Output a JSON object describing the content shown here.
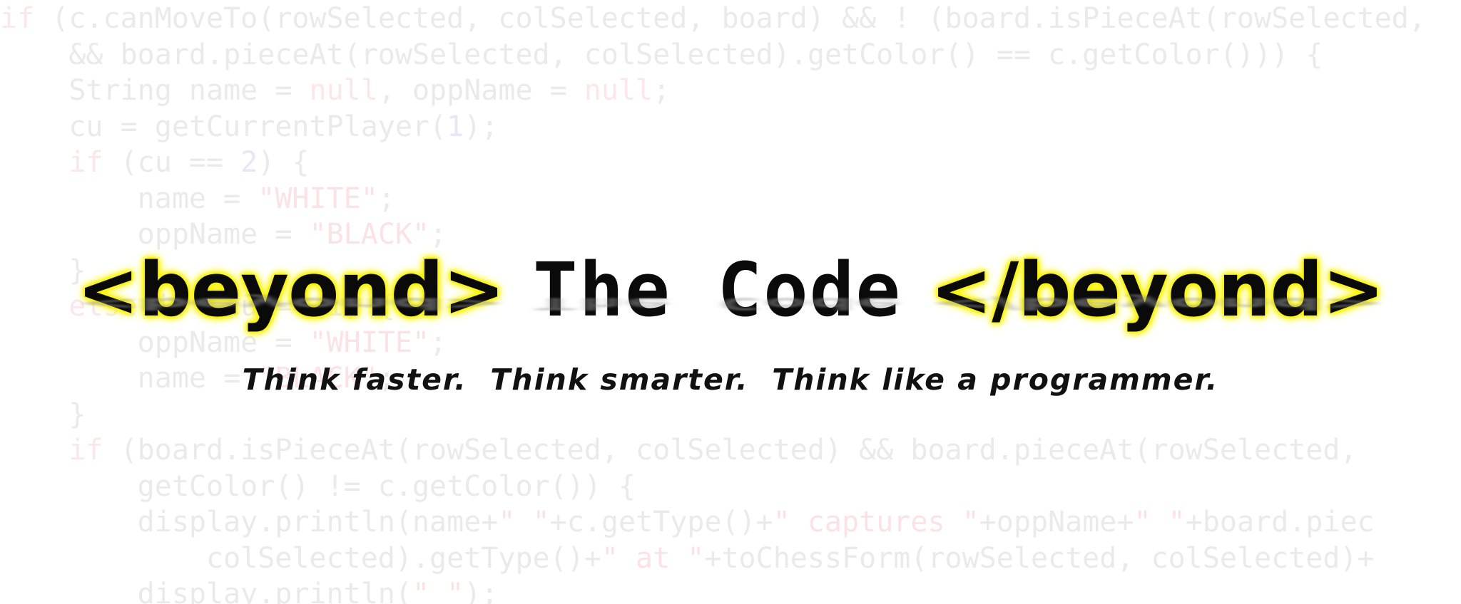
{
  "banner": {
    "open_tag": "<beyond>",
    "title": "The Code",
    "close_tag": "</beyond>",
    "tagline": "Think faster.  Think smarter.  Think like a programmer."
  },
  "code_background": [
    [
      {
        "t": "if",
        "c": "kw"
      },
      {
        "t": " (c.canMoveTo(rowSelected, colSelected, board) && ! (board.isPieceAt(rowSelected,"
      }
    ],
    [
      {
        "t": "    && board.pieceAt(rowSelected, colSelected).getColor() == c.getColor())) {"
      }
    ],
    [
      {
        "t": "    String name = "
      },
      {
        "t": "null",
        "c": "kw"
      },
      {
        "t": ", oppName = "
      },
      {
        "t": "null",
        "c": "kw"
      },
      {
        "t": ";"
      }
    ],
    [
      {
        "t": "    cu = getCurrentPlayer("
      },
      {
        "t": "1",
        "c": "num"
      },
      {
        "t": ");"
      }
    ],
    [
      {
        "t": "    "
      },
      {
        "t": "if",
        "c": "kw"
      },
      {
        "t": " (cu == "
      },
      {
        "t": "2",
        "c": "num"
      },
      {
        "t": ") {"
      }
    ],
    [
      {
        "t": "        name = "
      },
      {
        "t": "\"WHITE\"",
        "c": "str"
      },
      {
        "t": ";"
      }
    ],
    [
      {
        "t": "        oppName = "
      },
      {
        "t": "\"BLACK\"",
        "c": "str"
      },
      {
        "t": ";"
      }
    ],
    [
      {
        "t": "    }"
      }
    ],
    [
      {
        "t": "    "
      },
      {
        "t": "else",
        "c": "kw"
      },
      {
        "t": " if (cu == 1) {"
      }
    ],
    [
      {
        "t": "        oppName = "
      },
      {
        "t": "\"WHITE\"",
        "c": "str"
      },
      {
        "t": ";"
      }
    ],
    [
      {
        "t": "        name = "
      },
      {
        "t": "\"BLACK\"",
        "c": "str"
      },
      {
        "t": ";"
      }
    ],
    [
      {
        "t": "    }"
      }
    ],
    [
      {
        "t": "    "
      },
      {
        "t": "if",
        "c": "kw"
      },
      {
        "t": " (board.isPieceAt(rowSelected, colSelected) && board.pieceAt(rowSelected,"
      }
    ],
    [
      {
        "t": "        getColor() != c.getColor()) {"
      }
    ],
    [
      {
        "t": "        display.println(name+"
      },
      {
        "t": "\" \"",
        "c": "str"
      },
      {
        "t": "+c.getType()+"
      },
      {
        "t": "\" captures \"",
        "c": "str"
      },
      {
        "t": "+oppName+"
      },
      {
        "t": "\" \"",
        "c": "str"
      },
      {
        "t": "+board.piec"
      }
    ],
    [
      {
        "t": "            colSelected).getType()+"
      },
      {
        "t": "\" at \"",
        "c": "str"
      },
      {
        "t": "+toChessForm(rowSelected, colSelected)+"
      }
    ],
    [
      {
        "t": "        display.println("
      },
      {
        "t": "\" \"",
        "c": "str"
      },
      {
        "t": ");"
      }
    ]
  ]
}
